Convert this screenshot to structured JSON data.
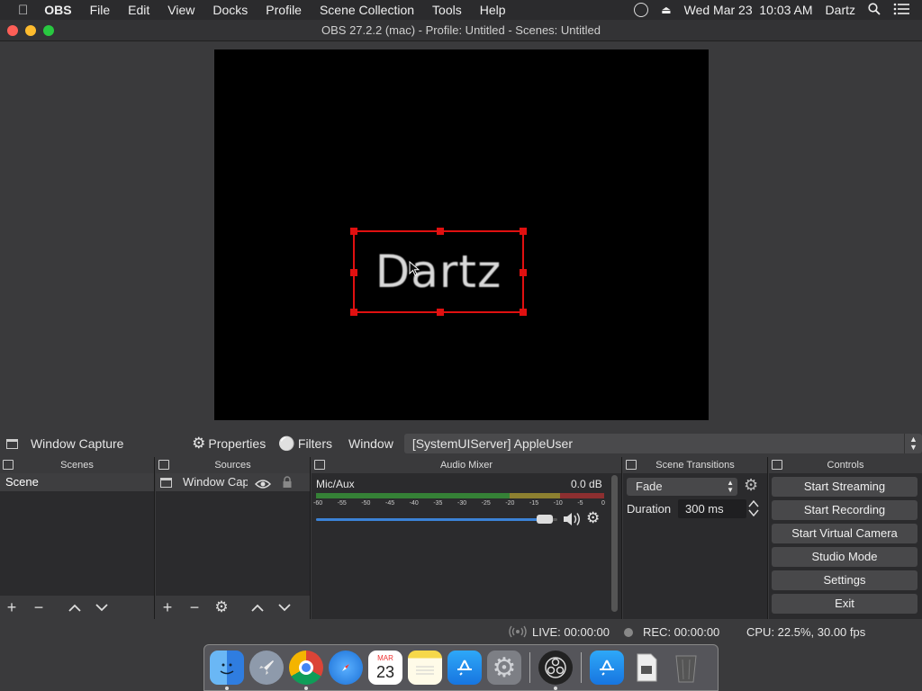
{
  "menubar": {
    "app_name": "OBS",
    "items": [
      "File",
      "Edit",
      "View",
      "Docks",
      "Profile",
      "Scene Collection",
      "Tools",
      "Help"
    ],
    "datetime": "Wed Mar 23  10:03 AM",
    "user": "Dartz"
  },
  "window": {
    "title": "OBS 27.2.2 (mac) - Profile: Untitled - Scenes: Untitled"
  },
  "preview": {
    "text": "Dartz"
  },
  "source_toolbar": {
    "source_name": "Window Capture",
    "properties_label": "Properties",
    "filters_label": "Filters",
    "window_label": "Window",
    "window_value": "[SystemUIServer] AppleUser"
  },
  "scenes": {
    "title": "Scenes",
    "items": [
      "Scene"
    ]
  },
  "sources": {
    "title": "Sources",
    "items": [
      "Window Cap"
    ]
  },
  "audio_mixer": {
    "title": "Audio Mixer",
    "channel": "Mic/Aux",
    "level": "0.0 dB",
    "ticks": [
      "-60",
      "-55",
      "-50",
      "-45",
      "-40",
      "-35",
      "-30",
      "-25",
      "-20",
      "-15",
      "-10",
      "-5",
      "0"
    ],
    "volume_fraction": 0.98
  },
  "scene_transitions": {
    "title": "Scene Transitions",
    "transition": "Fade",
    "duration_label": "Duration",
    "duration_value": "300 ms"
  },
  "controls": {
    "title": "Controls",
    "start_streaming": "Start Streaming",
    "start_recording": "Start Recording",
    "start_virtual_camera": "Start Virtual Camera",
    "studio_mode": "Studio Mode",
    "settings": "Settings",
    "exit": "Exit"
  },
  "status": {
    "live": "LIVE: 00:00:00",
    "rec": "REC: 00:00:00",
    "cpu": "CPU: 22.5%, 30.00 fps"
  },
  "dock": {
    "calendar_month": "MAR",
    "calendar_day": "23",
    "apps": [
      "finder-icon",
      "launchpad-icon",
      "chrome-icon",
      "safari-icon",
      "calendar-icon",
      "notes-icon",
      "app-store-icon",
      "system-preferences-icon",
      "obs-icon",
      "app-store-icon",
      "document-icon",
      "trash-icon"
    ]
  },
  "colors": {
    "selection": "#e01010",
    "accent": "#3b82d6",
    "meter_green": "#3aa63a",
    "meter_yellow": "#b8a532",
    "meter_red": "#b83232"
  }
}
